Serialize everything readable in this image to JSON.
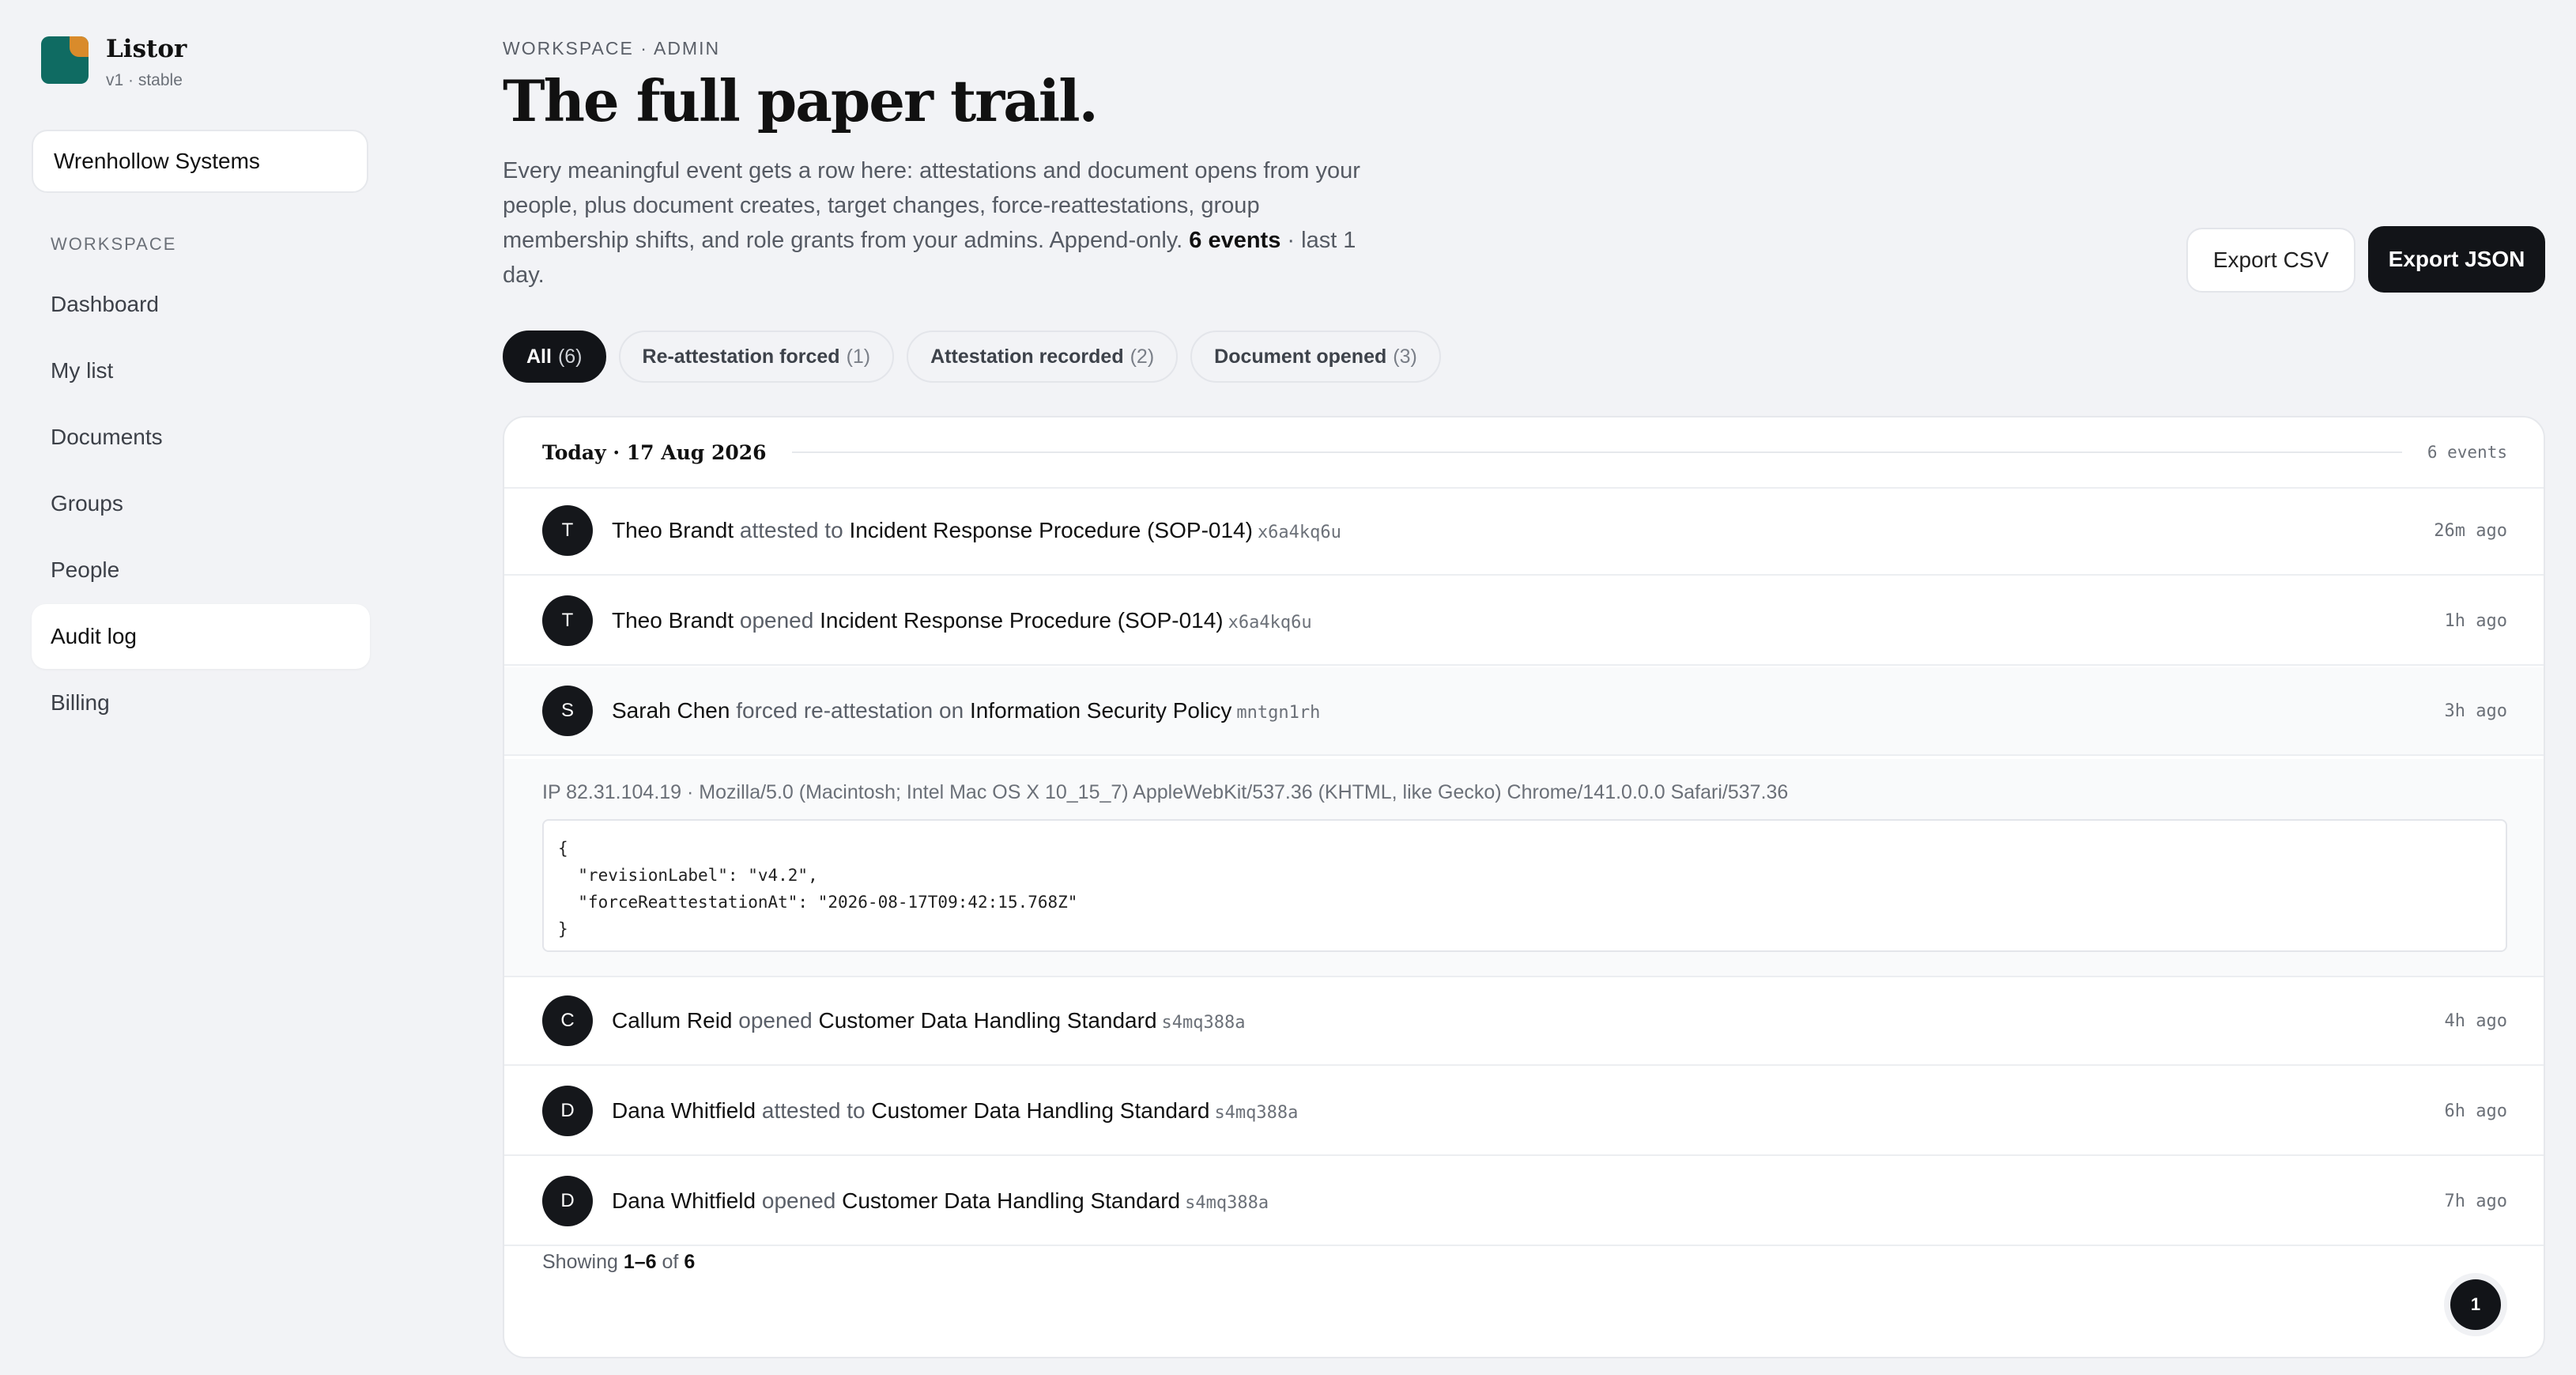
{
  "brand": {
    "name": "Listor",
    "version": "v1 · stable"
  },
  "org": {
    "name": "Wrenhollow Systems"
  },
  "nav": {
    "heading": "WORKSPACE",
    "items": [
      {
        "label": "Dashboard",
        "active": false
      },
      {
        "label": "My list",
        "active": false
      },
      {
        "label": "Documents",
        "active": false
      },
      {
        "label": "Groups",
        "active": false
      },
      {
        "label": "People",
        "active": false
      },
      {
        "label": "Audit log",
        "active": true
      },
      {
        "label": "Billing",
        "active": false
      }
    ]
  },
  "header": {
    "eyebrow": "WORKSPACE · ADMIN",
    "title": "The full paper trail.",
    "description": "Every meaningful event gets a row here: attestations and document opens from your people, plus document creates, target changes, force-reattestations, group membership shifts, and role grants from your admins. Append-only.",
    "events_count": "6 events",
    "range": "· last 1 day."
  },
  "actions": {
    "export_csv": "Export CSV",
    "export_json": "Export JSON"
  },
  "filters": [
    {
      "label": "All",
      "count": "(6)",
      "active": true
    },
    {
      "label": "Re-attestation forced",
      "count": "(1)",
      "active": false
    },
    {
      "label": "Attestation recorded",
      "count": "(2)",
      "active": false
    },
    {
      "label": "Document opened",
      "count": "(3)",
      "active": false
    }
  ],
  "day": {
    "label": "Today · 17 Aug 2026",
    "count": "6 events"
  },
  "events": [
    {
      "initial": "T",
      "actor": "Theo Brandt",
      "verb": "attested to",
      "target": "Incident Response Procedure (SOP-014)",
      "slug": "x6a4kq6u",
      "ago": "26m ago"
    },
    {
      "initial": "T",
      "actor": "Theo Brandt",
      "verb": "opened",
      "target": "Incident Response Procedure (SOP-014)",
      "slug": "x6a4kq6u",
      "ago": "1h ago"
    },
    {
      "initial": "S",
      "actor": "Sarah Chen",
      "verb": "forced re-attestation on",
      "target": "Information Security Policy",
      "slug": "mntgn1rh",
      "ago": "3h ago"
    },
    {
      "initial": "C",
      "actor": "Callum Reid",
      "verb": "opened",
      "target": "Customer Data Handling Standard",
      "slug": "s4mq388a",
      "ago": "4h ago"
    },
    {
      "initial": "D",
      "actor": "Dana Whitfield",
      "verb": "attested to",
      "target": "Customer Data Handling Standard",
      "slug": "s4mq388a",
      "ago": "6h ago"
    },
    {
      "initial": "D",
      "actor": "Dana Whitfield",
      "verb": "opened",
      "target": "Customer Data Handling Standard",
      "slug": "s4mq388a",
      "ago": "7h ago"
    }
  ],
  "detail": {
    "meta": "IP 82.31.104.19 · Mozilla/5.0 (Macintosh; Intel Mac OS X 10_15_7) AppleWebKit/537.36 (KHTML, like Gecko) Chrome/141.0.0.0 Safari/537.36",
    "json": "{\n  \"revisionLabel\": \"v4.2\",\n  \"forceReattestationAt\": \"2026-08-17T09:42:15.768Z\"\n}"
  },
  "footer": {
    "prefix": "Showing",
    "range": "1–6",
    "of": "of",
    "total": "6"
  },
  "pagination": {
    "current": "1"
  }
}
